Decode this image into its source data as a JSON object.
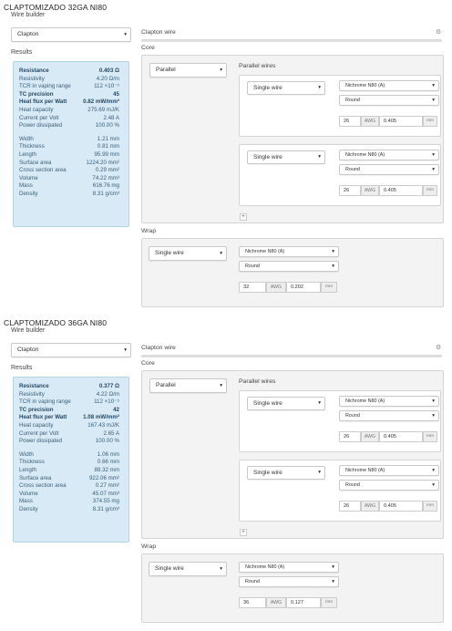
{
  "panels": [
    {
      "title": "CLAPTOMIZADO 32GA NI80",
      "wire_builder": "Wire builder",
      "type_select": "Clapton",
      "results_heading": "Results",
      "results": {
        "resistance": {
          "label": "Resistance",
          "value": "0.403 Ω"
        },
        "resistivity": {
          "label": "Resistivity",
          "value": "4.20 Ω/m"
        },
        "tcr": {
          "label": "TCR in vaping range",
          "value": "112 ×10⁻⁵"
        },
        "tc_precision": {
          "label": "TC precision",
          "value": "45"
        },
        "heat_flux": {
          "label": "Heat flux per Watt",
          "value": "0.82 mW/mm²"
        },
        "heat_capacity": {
          "label": "Heat capacity",
          "value": "275.69 mJ/K"
        },
        "current_per_volt": {
          "label": "Current per Volt",
          "value": "2.48 A"
        },
        "power_dissipated": {
          "label": "Power dissipated",
          "value": "100.00 %"
        },
        "width": {
          "label": "Width",
          "value": "1.21 mm"
        },
        "thickness": {
          "label": "Thickness",
          "value": "0.81 mm"
        },
        "length": {
          "label": "Length",
          "value": "95.99 mm"
        },
        "surface_area": {
          "label": "Surface area",
          "value": "1224.20 mm²"
        },
        "cross_section": {
          "label": "Cross section area",
          "value": "0.29 mm²"
        },
        "volume": {
          "label": "Volume",
          "value": "74.22 mm³"
        },
        "mass": {
          "label": "Mass",
          "value": "616.76 mg"
        },
        "density": {
          "label": "Density",
          "value": "8.31 g/cm³"
        }
      },
      "clapton_wire": "Clapton wire",
      "core_label": "Core",
      "core_select": "Parallel",
      "parallel_wires_label": "Parallel wires",
      "wires": [
        {
          "kind": "Single wire",
          "material": "Nichrome N80 (A)",
          "shape": "Round",
          "awg": "26",
          "awg_label": "AWG",
          "diameter": "0.405",
          "unit": "mm"
        },
        {
          "kind": "Single wire",
          "material": "Nichrome N80 (A)",
          "shape": "Round",
          "awg": "26",
          "awg_label": "AWG",
          "diameter": "0.405",
          "unit": "mm"
        }
      ],
      "add_symbol": "+",
      "wrap_label": "Wrap",
      "wrap": {
        "kind": "Single wire",
        "material": "Nichrome N80 (A)",
        "shape": "Round",
        "awg": "32",
        "awg_label": "AWG",
        "diameter": "0.202",
        "unit": "mm"
      }
    },
    {
      "title": "CLAPTOMIZADO 36GA NI80",
      "wire_builder": "Wire builder",
      "type_select": "Clapton",
      "results_heading": "Results",
      "results": {
        "resistance": {
          "label": "Resistance",
          "value": "0.377 Ω"
        },
        "resistivity": {
          "label": "Resistivity",
          "value": "4.22 Ω/m"
        },
        "tcr": {
          "label": "TCR in vaping range",
          "value": "112 ×10⁻⁵"
        },
        "tc_precision": {
          "label": "TC precision",
          "value": "42"
        },
        "heat_flux": {
          "label": "Heat flux per Watt",
          "value": "1.08 mW/mm²"
        },
        "heat_capacity": {
          "label": "Heat capacity",
          "value": "167.43 mJ/K"
        },
        "current_per_volt": {
          "label": "Current per Volt",
          "value": "2.65 A"
        },
        "power_dissipated": {
          "label": "Power dissipated",
          "value": "100.00 %"
        },
        "width": {
          "label": "Width",
          "value": "1.06 mm"
        },
        "thickness": {
          "label": "Thickness",
          "value": "0.66 mm"
        },
        "length": {
          "label": "Length",
          "value": "89.32 mm"
        },
        "surface_area": {
          "label": "Surface area",
          "value": "922.06 mm²"
        },
        "cross_section": {
          "label": "Cross section area",
          "value": "0.27 mm²"
        },
        "volume": {
          "label": "Volume",
          "value": "45.07 mm³"
        },
        "mass": {
          "label": "Mass",
          "value": "374.55 mg"
        },
        "density": {
          "label": "Density",
          "value": "8.31 g/cm³"
        }
      },
      "clapton_wire": "Clapton wire",
      "core_label": "Core",
      "core_select": "Parallel",
      "parallel_wires_label": "Parallel wires",
      "wires": [
        {
          "kind": "Single wire",
          "material": "Nichrome N80 (A)",
          "shape": "Round",
          "awg": "26",
          "awg_label": "AWG",
          "diameter": "0.405",
          "unit": "mm"
        },
        {
          "kind": "Single wire",
          "material": "Nichrome N80 (A)",
          "shape": "Round",
          "awg": "26",
          "awg_label": "AWG",
          "diameter": "0.405",
          "unit": "mm"
        }
      ],
      "add_symbol": "+",
      "wrap_label": "Wrap",
      "wrap": {
        "kind": "Single wire",
        "material": "Nichrome N80 (A)",
        "shape": "Round",
        "awg": "36",
        "awg_label": "AWG",
        "diameter": "0.127",
        "unit": "mm"
      }
    }
  ],
  "icons": {
    "caret": "▾",
    "gear": "⚙"
  }
}
